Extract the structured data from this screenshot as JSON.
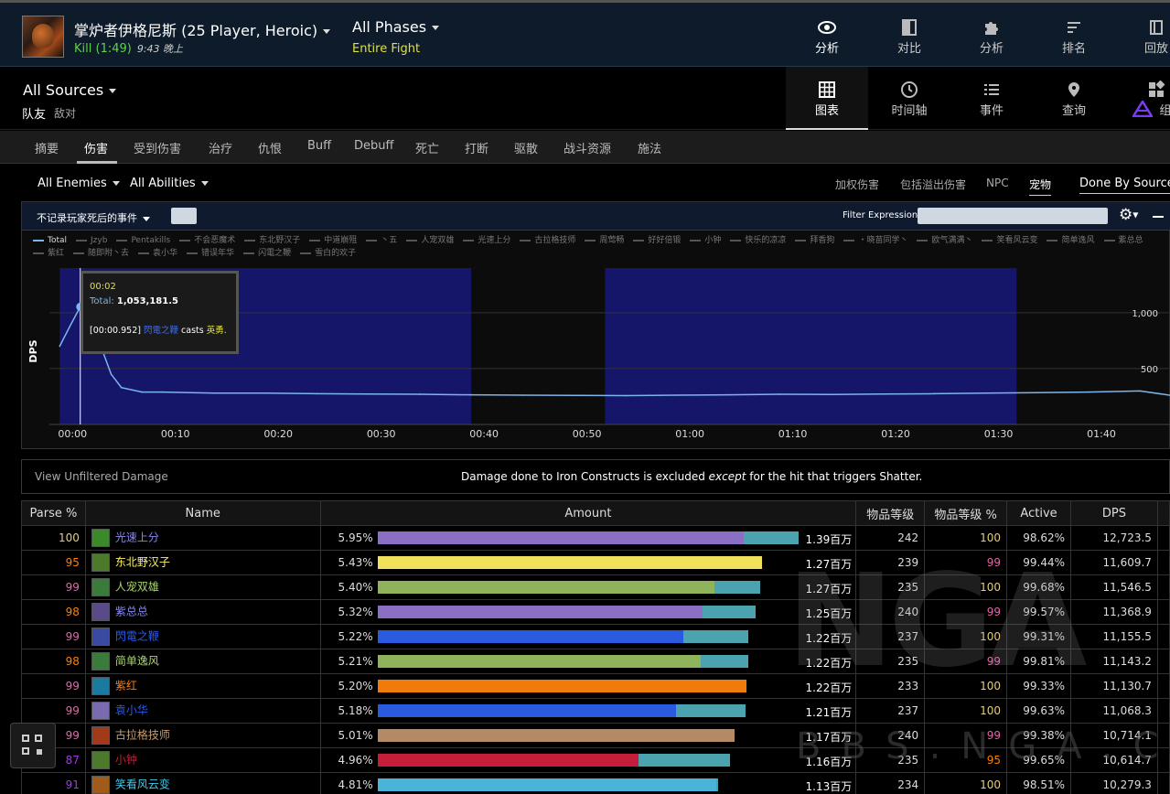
{
  "header": {
    "boss_name": "掌炉者伊格尼斯 (25 Player, Heroic)",
    "result": "Kill (1:49)",
    "time": "9:43 晚上",
    "phase": "All Phases",
    "phase_sub": "Entire Fight",
    "nav": [
      {
        "label": "分析",
        "icon": "eye-icon",
        "active": true
      },
      {
        "label": "对比",
        "icon": "compare-icon"
      },
      {
        "label": "分析",
        "icon": "puzzle-icon"
      },
      {
        "label": "排名",
        "icon": "ranking-icon"
      },
      {
        "label": "回放",
        "icon": "replay-icon"
      }
    ]
  },
  "sources": {
    "title": "All Sources",
    "friendly": "队友",
    "enemy": "敌对",
    "views": [
      {
        "label": "图表",
        "icon": "grid-icon",
        "active": true
      },
      {
        "label": "时间轴",
        "icon": "clock-icon"
      },
      {
        "label": "事件",
        "icon": "list-icon"
      },
      {
        "label": "查询",
        "icon": "pin-icon"
      },
      {
        "label": "组",
        "icon": "widgets-icon"
      }
    ]
  },
  "tabs": [
    "摘要",
    "伤害",
    "受到伤害",
    "治疗",
    "仇恨",
    "Buff",
    "Debuff",
    "死亡",
    "打断",
    "驱散",
    "战斗资源",
    "施法"
  ],
  "active_tab": "伤害",
  "filters": {
    "enemies": "All Enemies",
    "abilities": "All Abilities",
    "options": [
      "加权伤害",
      "包括溢出伤害",
      "NPC",
      "宠物",
      "Done By Source"
    ],
    "active_option": "宠物"
  },
  "graph": {
    "death_filter": "不记录玩家死后的事件",
    "filter_label": "Filter Expression:",
    "filter_value": "",
    "legend": [
      "Total",
      "Jzyb",
      "Pentakills",
      "不会恶魔术",
      "东北野汉子",
      "中道崩殂",
      "丶五",
      "人宠双雄",
      "光速上分",
      "古拉格技师",
      "周莺畅",
      "好好倍锻",
      "小钟",
      "快乐的凉凉",
      "拜香狗",
      "・晓苗同学丶",
      "欧气满满丶",
      "笑看风云变",
      "简单逸风",
      "紫总总",
      "紫红",
      "随即附丶去",
      "袁小华",
      "错误年华",
      "闪電之鞭",
      "雪白的欢子"
    ],
    "y_label": "DPS",
    "y_ticks": [
      "1,000",
      "500"
    ],
    "x_ticks": [
      "00:00",
      "00:10",
      "00:20",
      "00:30",
      "00:40",
      "00:50",
      "01:00",
      "01:10",
      "01:20",
      "01:30",
      "01:40"
    ],
    "tooltip": {
      "time": "00:02",
      "total_label": "Total:",
      "total_value": "1,053,181.5",
      "cast_time": "[00:00.952]",
      "cast_who": "閃電之鞭",
      "cast_verb": "casts",
      "cast_spell": "英勇."
    }
  },
  "chart_data": {
    "type": "line",
    "series": [
      {
        "name": "Total",
        "color": "#7cb5ec"
      }
    ],
    "x_unit": "seconds",
    "x": [
      0,
      1,
      2,
      3,
      4,
      5,
      6,
      8,
      10,
      15,
      20,
      25,
      30,
      35,
      40,
      45,
      50,
      55,
      60,
      65,
      70,
      75,
      80,
      85,
      90,
      95,
      100,
      105,
      108
    ],
    "y_unit": "thousand DPS",
    "y": [
      700,
      880,
      1053,
      980,
      700,
      450,
      330,
      290,
      290,
      280,
      280,
      275,
      272,
      270,
      265,
      262,
      260,
      258,
      262,
      265,
      270,
      268,
      272,
      275,
      280,
      285,
      290,
      300,
      260
    ],
    "shaded_bands": [
      [
        0,
        40
      ],
      [
        53,
        93
      ]
    ],
    "ylim": [
      0,
      1400
    ],
    "xlim": [
      -1,
      108
    ],
    "ylabel": "DPS",
    "grid": true
  },
  "notice": {
    "link": "View Unfiltered Damage",
    "pre": "Damage done to Iron Constructs is excluded ",
    "em": "except",
    "post": " for the hit that triggers Shatter."
  },
  "table": {
    "headers": [
      "Parse %",
      "Name",
      "Amount",
      "物品等级",
      "物品等级 %",
      "Active",
      "DPS"
    ],
    "rows": [
      {
        "parse": "100",
        "parse_color": "#e5cc80",
        "name": "光速上分",
        "name_color": "#8788ee",
        "icon_color": "#3a8a2a",
        "pct": "5.95%",
        "main": 0.852,
        "pet": 0.128,
        "bar_color": "#8a6fc4",
        "amount": "1.39百万",
        "ilvl": "242",
        "ilvl_pct": "100",
        "ilvl_pct_color": "#e5cc80",
        "active": "98.62%",
        "dps": "12,723.5"
      },
      {
        "parse": "95",
        "parse_color": "#ff8000",
        "name": "东北野汉子",
        "name_color": "#fff468",
        "icon_color": "#4a7a2a",
        "pct": "5.43%",
        "main": 0.894,
        "pet": 0.0,
        "bar_color": "#f0e05a",
        "amount": "1.27百万",
        "ilvl": "239",
        "ilvl_pct": "99",
        "ilvl_pct_color": "#e268a8",
        "active": "99.44%",
        "dps": "11,609.7"
      },
      {
        "parse": "99",
        "parse_color": "#e268a8",
        "name": "人宠双雄",
        "name_color": "#aad372",
        "icon_color": "#3a7a3a",
        "pct": "5.40%",
        "main": 0.783,
        "pet": 0.106,
        "bar_color": "#8fb35a",
        "amount": "1.27百万",
        "ilvl": "235",
        "ilvl_pct": "100",
        "ilvl_pct_color": "#e5cc80",
        "active": "99.68%",
        "dps": "11,546.5"
      },
      {
        "parse": "98",
        "parse_color": "#ff8000",
        "name": "紫总总",
        "name_color": "#8788ee",
        "icon_color": "#5a4a8a",
        "pct": "5.32%",
        "main": 0.755,
        "pet": 0.123,
        "bar_color": "#8a6fc4",
        "amount": "1.25百万",
        "ilvl": "240",
        "ilvl_pct": "99",
        "ilvl_pct_color": "#e268a8",
        "active": "99.57%",
        "dps": "11,368.9"
      },
      {
        "parse": "99",
        "parse_color": "#e268a8",
        "name": "閃電之鞭",
        "name_color": "#2a5af0",
        "icon_color": "#3a4aa0",
        "pct": "5.22%",
        "main": 0.711,
        "pet": 0.151,
        "bar_color": "#2a5ae0",
        "amount": "1.22百万",
        "ilvl": "237",
        "ilvl_pct": "100",
        "ilvl_pct_color": "#e5cc80",
        "active": "99.31%",
        "dps": "11,155.5"
      },
      {
        "parse": "98",
        "parse_color": "#ff8000",
        "name": "简单逸风",
        "name_color": "#aad372",
        "icon_color": "#3a7a3a",
        "pct": "5.21%",
        "main": 0.751,
        "pet": 0.111,
        "bar_color": "#8fb35a",
        "amount": "1.22百万",
        "ilvl": "235",
        "ilvl_pct": "99",
        "ilvl_pct_color": "#e268a8",
        "active": "99.81%",
        "dps": "11,143.2"
      },
      {
        "parse": "99",
        "parse_color": "#e268a8",
        "name": "紫红",
        "name_color": "#ff7c0a",
        "icon_color": "#1a7aa0",
        "pct": "5.20%",
        "main": 0.857,
        "pet": 0.0,
        "bar_color": "#f07a0a",
        "amount": "1.22百万",
        "ilvl": "233",
        "ilvl_pct": "100",
        "ilvl_pct_color": "#e5cc80",
        "active": "99.33%",
        "dps": "11,130.7"
      },
      {
        "parse": "99",
        "parse_color": "#e268a8",
        "name": "袁小华",
        "name_color": "#2a5af0",
        "icon_color": "#7a6ab0",
        "pct": "5.18%",
        "main": 0.694,
        "pet": 0.162,
        "bar_color": "#2a5ae0",
        "amount": "1.21百万",
        "ilvl": "237",
        "ilvl_pct": "100",
        "ilvl_pct_color": "#e5cc80",
        "active": "99.63%",
        "dps": "11,068.3"
      },
      {
        "parse": "99",
        "parse_color": "#e268a8",
        "name": "古拉格技师",
        "name_color": "#c69b6d",
        "icon_color": "#a03a1a",
        "pct": "5.01%",
        "main": 0.83,
        "pet": 0.0,
        "bar_color": "#b48a64",
        "amount": "1.17百万",
        "ilvl": "240",
        "ilvl_pct": "99",
        "ilvl_pct_color": "#e268a8",
        "active": "99.38%",
        "dps": "10,714.1"
      },
      {
        "parse": "87",
        "parse_color": "#a335ee",
        "name": "小钟",
        "name_color": "#c41e3a",
        "icon_color": "#4a7a2a",
        "pct": "4.96%",
        "main": 0.606,
        "pet": 0.213,
        "bar_color": "#c41e3a",
        "amount": "1.16百万",
        "ilvl": "235",
        "ilvl_pct": "95",
        "ilvl_pct_color": "#ff8000",
        "active": "99.65%",
        "dps": "10,614.7"
      },
      {
        "parse": "91",
        "parse_color": "#a335ee",
        "name": "笑看风云变",
        "name_color": "#3fc7eb",
        "icon_color": "#a05a1a",
        "pct": "4.81%",
        "main": 0.787,
        "pet": 0.004,
        "bar_color": "#4ab3d8",
        "amount": "1.13百万",
        "ilvl": "234",
        "ilvl_pct": "100",
        "ilvl_pct_color": "#e5cc80",
        "active": "98.51%",
        "dps": "10,279.3"
      }
    ]
  },
  "watermark": {
    "letters": "NGA",
    "domain": "BBS.NGA.CN"
  }
}
